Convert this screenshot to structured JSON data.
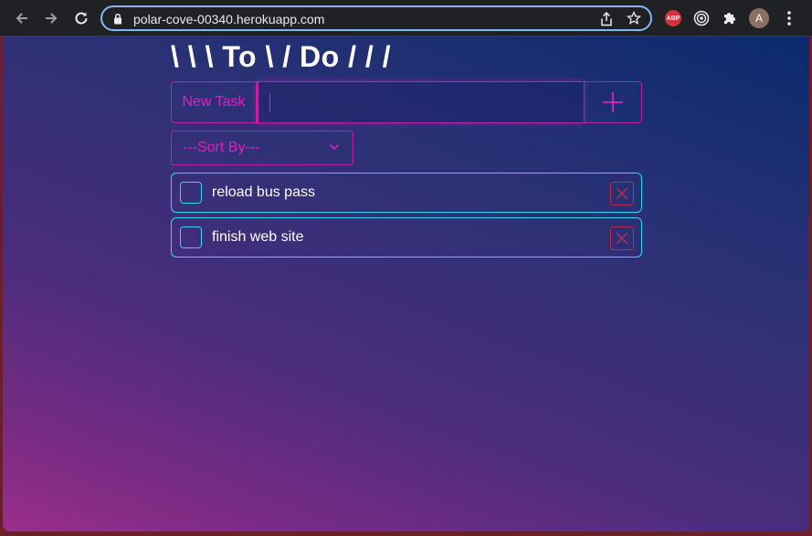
{
  "browser": {
    "url": "polar-cove-00340.herokuapp.com",
    "extensions": {
      "adblock_label": "ABP",
      "avatar_initial": "A"
    }
  },
  "app": {
    "title": "\\ \\ \\ To \\ / Do / / /",
    "new_task_label": "New Task",
    "new_task_value": "",
    "sort_selected": "---Sort By---",
    "todos": [
      {
        "text": "reload bus pass",
        "done": false
      },
      {
        "text": "finish web site",
        "done": false
      }
    ]
  },
  "colors": {
    "accent_magenta": "#e020c3",
    "accent_cyan": "#35d5f5",
    "delete_red": "#c2294c"
  },
  "icons": [
    "back-arrow-icon",
    "forward-arrow-icon",
    "reload-icon",
    "lock-icon",
    "share-icon",
    "star-icon",
    "target-icon",
    "puzzle-icon",
    "more-vertical-icon",
    "plus-icon",
    "chevron-down-icon",
    "close-icon"
  ]
}
